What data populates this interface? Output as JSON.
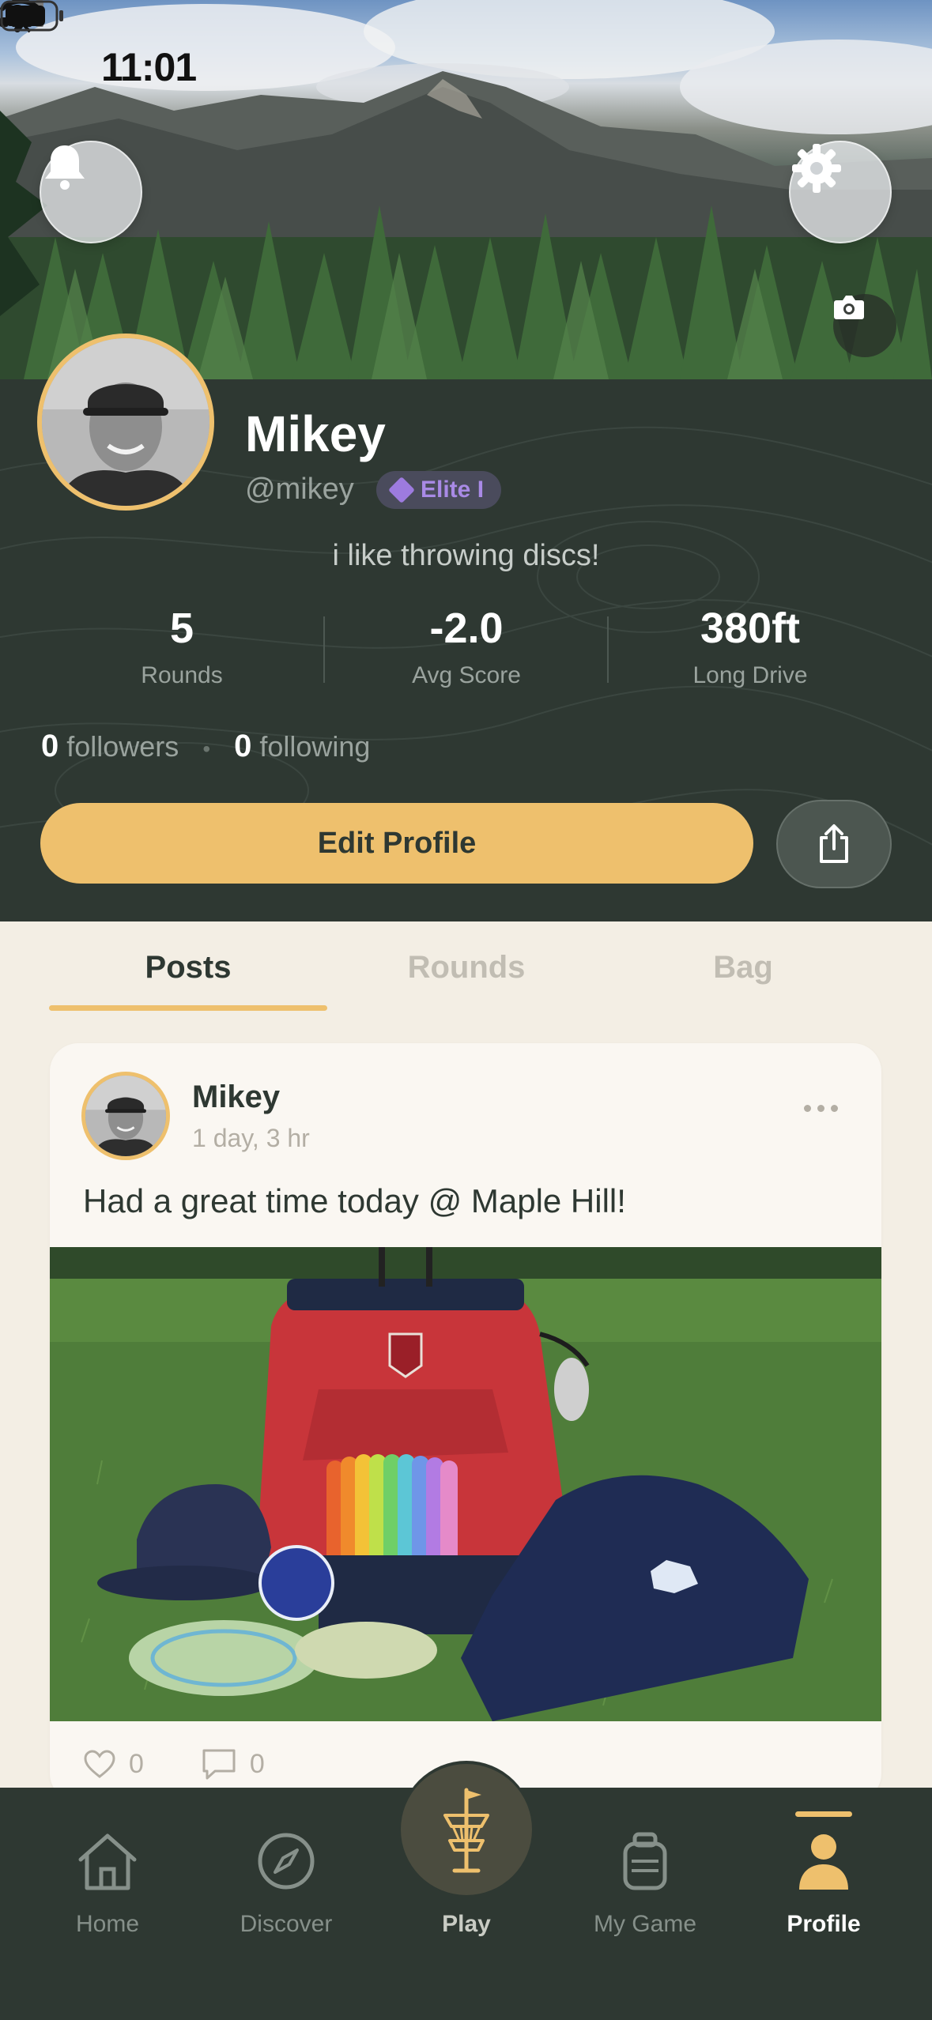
{
  "status_bar": {
    "time": "11:01"
  },
  "profile": {
    "name": "Mikey",
    "handle": "@mikey",
    "badge": "Elite I",
    "bio": "i like throwing discs!",
    "stats": [
      {
        "value": "5",
        "label": "Rounds"
      },
      {
        "value": "-2.0",
        "label": "Avg Score"
      },
      {
        "value": "380ft",
        "label": "Long Drive"
      }
    ],
    "followers_count": "0",
    "followers_label": "followers",
    "following_count": "0",
    "following_label": "following",
    "edit_button": "Edit Profile"
  },
  "tabs": [
    {
      "label": "Posts",
      "active": true
    },
    {
      "label": "Rounds",
      "active": false
    },
    {
      "label": "Bag",
      "active": false
    }
  ],
  "post": {
    "author": "Mikey",
    "time": "1 day, 3 hr",
    "text": "Had a great time today @ Maple Hill!",
    "likes": "0",
    "comments": "0"
  },
  "nav": {
    "items": [
      {
        "label": "Home",
        "icon": "home-icon"
      },
      {
        "label": "Discover",
        "icon": "compass-icon"
      },
      {
        "label": "Play",
        "icon": "disc-golf-basket-icon"
      },
      {
        "label": "My Game",
        "icon": "bag-icon"
      },
      {
        "label": "Profile",
        "icon": "person-icon"
      }
    ],
    "active": "Profile"
  },
  "colors": {
    "accent": "#eec06d",
    "dark": "#2e3832",
    "background": "#f3eee4",
    "badge_purple": "#9d7bdf"
  }
}
